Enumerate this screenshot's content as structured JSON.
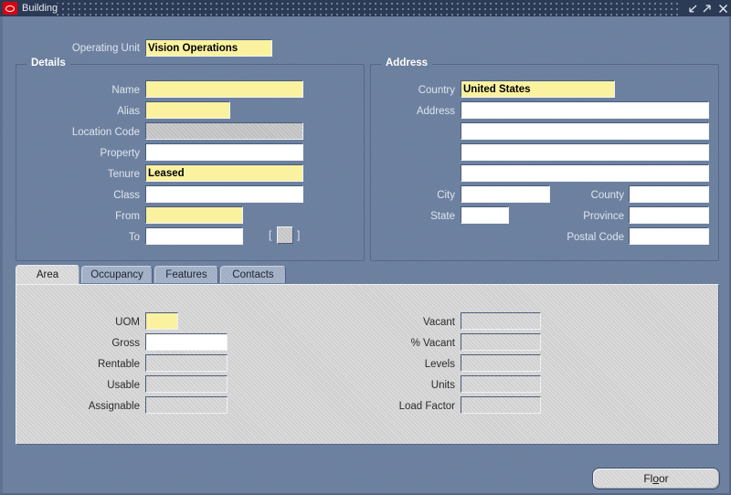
{
  "window": {
    "title": "Building",
    "logo_icon": "oracle-logo-icon",
    "controls": [
      {
        "name": "minimize-button",
        "icon": "minimize-arrow-icon"
      },
      {
        "name": "maximize-button",
        "icon": "maximize-arrow-icon"
      },
      {
        "name": "close-button",
        "icon": "close-x-icon"
      }
    ]
  },
  "header": {
    "operating_unit_label": "Operating Unit",
    "operating_unit_value": "Vision Operations"
  },
  "details": {
    "title": "Details",
    "fields": [
      {
        "label": "Name",
        "value": "",
        "state": "yellow",
        "caret": true
      },
      {
        "label": "Alias",
        "value": "",
        "state": "yellow"
      },
      {
        "label": "Location Code",
        "value": "",
        "state": "disabled"
      },
      {
        "label": "Property",
        "value": "",
        "state": "white"
      },
      {
        "label": "Tenure",
        "value": "Leased",
        "state": "yellow"
      },
      {
        "label": "Class",
        "value": "",
        "state": "white"
      },
      {
        "label": "From",
        "value": "",
        "state": "yellow"
      },
      {
        "label": "To",
        "value": "",
        "state": "white"
      }
    ],
    "lov_bracket_open": "[",
    "lov_bracket_close": "]"
  },
  "address": {
    "title": "Address",
    "country_label": "Country",
    "country_value": "United States",
    "address_label": "Address",
    "address_lines": [
      "",
      "",
      "",
      ""
    ],
    "city_label": "City",
    "city_value": "",
    "state_label": "State",
    "state_value": "",
    "county_label": "County",
    "county_value": "",
    "province_label": "Province",
    "province_value": "",
    "postal_code_label": "Postal Code",
    "postal_code_value": ""
  },
  "tabs": [
    {
      "label": "Area",
      "active": true
    },
    {
      "label": "Occupancy",
      "active": false
    },
    {
      "label": "Features",
      "active": false
    },
    {
      "label": "Contacts",
      "active": false
    }
  ],
  "area_tab": {
    "left_fields": [
      {
        "label": "UOM",
        "value": "",
        "state": "yellow"
      },
      {
        "label": "Gross",
        "value": "",
        "state": "white"
      },
      {
        "label": "Rentable",
        "value": "",
        "state": "disabled"
      },
      {
        "label": "Usable",
        "value": "",
        "state": "disabled"
      },
      {
        "label": "Assignable",
        "value": "",
        "state": "disabled"
      }
    ],
    "right_fields": [
      {
        "label": "Vacant",
        "value": "",
        "state": "disabled"
      },
      {
        "label": "% Vacant",
        "value": "",
        "state": "disabled"
      },
      {
        "label": "Levels",
        "value": "",
        "state": "disabled"
      },
      {
        "label": "Units",
        "value": "",
        "state": "disabled"
      },
      {
        "label": "Load Factor",
        "value": "",
        "state": "disabled"
      }
    ]
  },
  "footer": {
    "floor_button_label": "Floor",
    "floor_button_mnemonic": "o"
  },
  "colors": {
    "window_bg": "#6b7f9e",
    "titlebar_bg": "#2b3a55",
    "required_field": "#fbf2a0",
    "enabled_field": "#ffffff",
    "disabled_field": "#bfbfbf",
    "tab_panel": "#d0d0d0",
    "logo_red": "#d9000f"
  }
}
